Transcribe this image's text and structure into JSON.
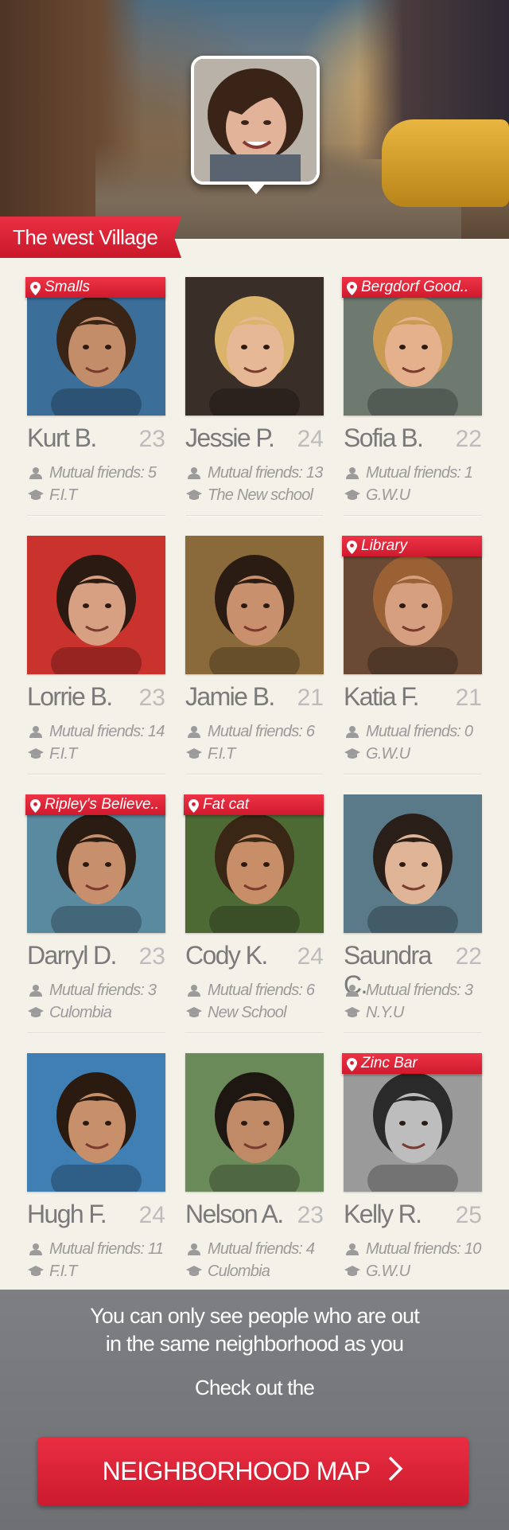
{
  "header": {
    "neighborhood": "The west Village"
  },
  "people": [
    {
      "name": "Kurt B.",
      "age": "23",
      "mutual": "Mutual friends: 5",
      "school": "F.I.T",
      "place": "Smalls",
      "photo_bg": "#3b6f9a",
      "skin": "#c48d6a",
      "hair": "#3a2416"
    },
    {
      "name": "Jessie P.",
      "age": "24",
      "mutual": "Mutual friends: 13",
      "school": "The New school",
      "place": "",
      "photo_bg": "#3a2e28",
      "skin": "#e7b896",
      "hair": "#d9b46a"
    },
    {
      "name": "Sofia B.",
      "age": "22",
      "mutual": "Mutual friends: 1",
      "school": "G.W.U",
      "place": "Bergdorf Good..",
      "photo_bg": "#6e7a70",
      "skin": "#e5b08c",
      "hair": "#c89a52"
    },
    {
      "name": "Lorrie B.",
      "age": "23",
      "mutual": "Mutual friends: 14",
      "school": "F.I.T",
      "place": "",
      "photo_bg": "#c9322d",
      "skin": "#d8a082",
      "hair": "#2a1a12"
    },
    {
      "name": "Jamie B.",
      "age": "21",
      "mutual": "Mutual friends: 6",
      "school": "F.I.T",
      "place": "",
      "photo_bg": "#8a6a3a",
      "skin": "#c8906c",
      "hair": "#2a1c12"
    },
    {
      "name": "Katia F.",
      "age": "21",
      "mutual": "Mutual friends: 0",
      "school": "G.W.U",
      "place": "Library",
      "photo_bg": "#6a4a34",
      "skin": "#d6a080",
      "hair": "#9a6234"
    },
    {
      "name": "Darryl D.",
      "age": "23",
      "mutual": "Mutual friends: 3",
      "school": "Culombia",
      "place": "Ripley's Believe..",
      "photo_bg": "#5a8aa0",
      "skin": "#c88f6c",
      "hair": "#2a1c12"
    },
    {
      "name": "Cody K.",
      "age": "24",
      "mutual": "Mutual friends: 6",
      "school": "New School",
      "place": "Fat cat",
      "photo_bg": "#4e6a34",
      "skin": "#c88e68",
      "hair": "#3a2614"
    },
    {
      "name": "Saundra C.",
      "age": "22",
      "mutual": "Mutual friends: 3",
      "school": "N.Y.U",
      "place": "",
      "photo_bg": "#5a7a8a",
      "skin": "#e0b496",
      "hair": "#2a1e18"
    },
    {
      "name": "Hugh F.",
      "age": "24",
      "mutual": "Mutual friends: 11",
      "school": "F.I.T",
      "place": "",
      "photo_bg": "#3f7fb4",
      "skin": "#c8906a",
      "hair": "#2a1a10"
    },
    {
      "name": "Nelson A.",
      "age": "23",
      "mutual": "Mutual friends: 4",
      "school": "Culombia",
      "place": "",
      "photo_bg": "#6a8a5a",
      "skin": "#c08a66",
      "hair": "#1e1610"
    },
    {
      "name": "Kelly R.",
      "age": "25",
      "mutual": "Mutual friends: 10",
      "school": "G.W.U",
      "place": "Zinc Bar",
      "photo_bg": "#9a9a9a",
      "skin": "#bdbdbd",
      "hair": "#2a2a2a"
    }
  ],
  "footer": {
    "line1": "You can only see people who are out",
    "line2": "in the same neighborhood as you",
    "check": "Check out the",
    "button_label": "NEIGHBORHOOD MAP"
  },
  "colors": {
    "accent_red": "#d81f33",
    "footer_gray": "#76787c",
    "background": "#f3f1e8"
  },
  "icons": {
    "person": "person-icon",
    "school": "graduation-cap-icon",
    "pin": "map-pin-icon",
    "chevron": "chevron-right-icon"
  }
}
